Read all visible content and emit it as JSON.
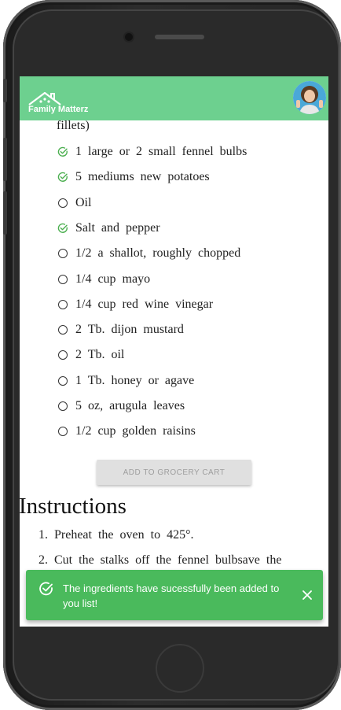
{
  "app": {
    "name": "Family Matterz"
  },
  "ingredients": {
    "fragment": "fillets)",
    "items": [
      {
        "label": "1 large or 2 small fennel bulbs",
        "checked": true
      },
      {
        "label": "5 mediums new potatoes",
        "checked": true
      },
      {
        "label": "Oil",
        "checked": false
      },
      {
        "label": "Salt and pepper",
        "checked": true
      },
      {
        "label": "1/2 a shallot, roughly chopped",
        "checked": false
      },
      {
        "label": "1/4 cup mayo",
        "checked": false
      },
      {
        "label": "1/4 cup red wine vinegar",
        "checked": false
      },
      {
        "label": "2 Tb. dijon mustard",
        "checked": false
      },
      {
        "label": "2 Tb. oil",
        "checked": false
      },
      {
        "label": "1 Tb. honey or agave",
        "checked": false
      },
      {
        "label": "5 oz, arugula leaves",
        "checked": false
      },
      {
        "label": "1/2 cup golden raisins",
        "checked": false
      }
    ],
    "add_button": "ADD TO GROCERY CART"
  },
  "instructions": {
    "title": "Instructions",
    "steps": [
      {
        "num": "1.",
        "text": "Preheat the oven to 425°."
      },
      {
        "num": "2.",
        "text": "Cut the stalks off the fennel bulbsave the"
      }
    ]
  },
  "toast": {
    "message": "The ingredients have sucessfully been added to you list!"
  },
  "colors": {
    "header": "#6dd08f",
    "toast": "#4aba5c",
    "check": "#4caf50"
  }
}
